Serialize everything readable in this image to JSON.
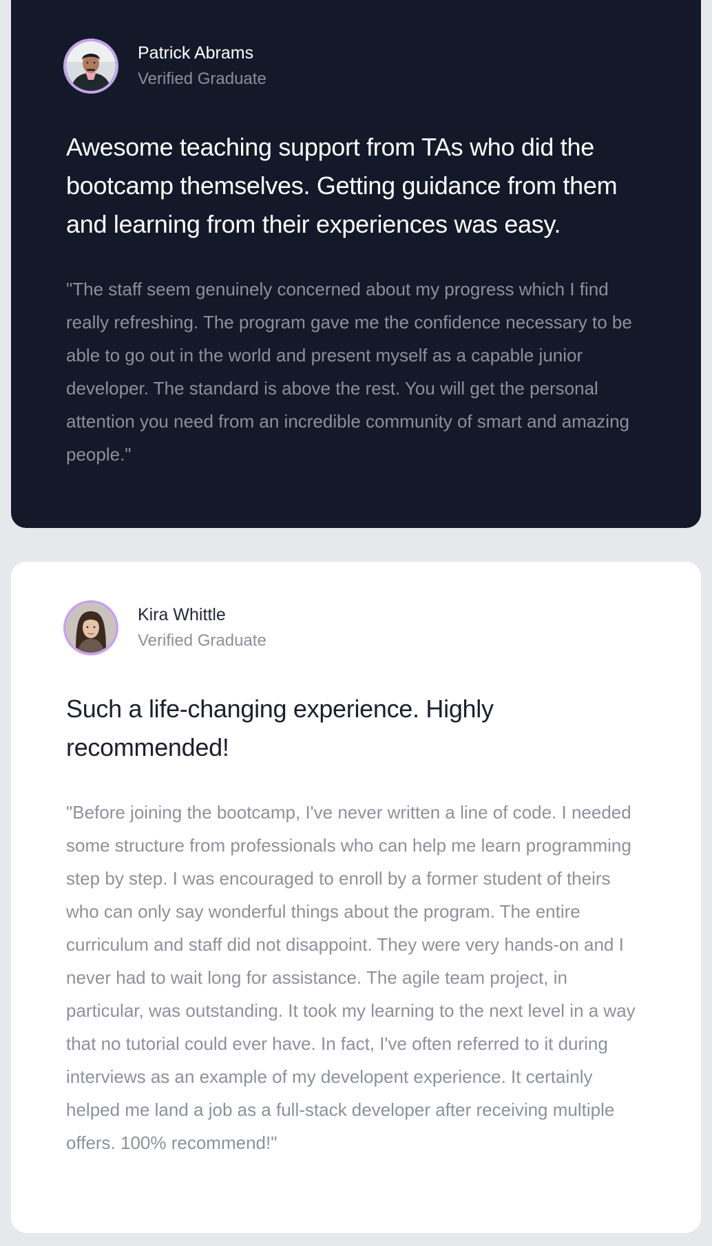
{
  "testimonials": [
    {
      "author": {
        "name": "Patrick Abrams",
        "role": "Verified Graduate",
        "avatar_icon": "avatar-patrick"
      },
      "headline": "Awesome teaching support from TAs who did the bootcamp themselves. Getting guidance from them and learning from their experiences was easy.",
      "quote": "\"The staff seem genuinely concerned about my progress which I find really refreshing. The program gave me the confidence necessary to be able to go out in the world and present myself as a capable junior developer. The standard is above the rest. You will get the personal attention you need from an incredible community of smart and amazing people.\""
    },
    {
      "author": {
        "name": "Kira Whittle",
        "role": "Verified Graduate",
        "avatar_icon": "avatar-kira"
      },
      "headline": "Such a life-changing experience. Highly recommended!",
      "quote": "\"Before joining the bootcamp, I've never written a line of code. I needed some structure from professionals who can help me learn programming step by step. I was encouraged to enroll by a former student of theirs who can only say wonderful things about the program. The entire curriculum and staff did not disappoint. They were very hands-on and I never had to wait long for assistance. The agile team project, in particular, was outstanding. It took my learning to the next level in a way that no tutorial could ever have. In fact, I've often referred to it during interviews as an example of my developent experience. It certainly helped me land a job as a full-stack developer after receiving multiple offers. 100% recommend!\""
    }
  ],
  "colors": {
    "page_background": "#e7e8ec",
    "dark_card": "#131929",
    "light_card": "#ffffff",
    "avatar_border": "#c8a2ec",
    "muted_text": "#8d909b"
  }
}
